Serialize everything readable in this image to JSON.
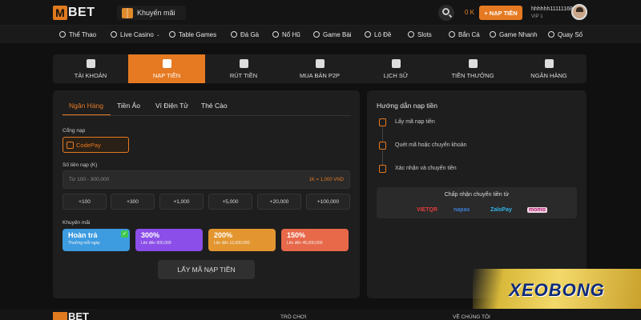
{
  "brand": {
    "logo_letter": "M",
    "logo_text": "BET"
  },
  "header": {
    "promo_label": "Khuyến mãi",
    "balance": "0 K",
    "deposit_button": "+ NẠP TIỀN",
    "username": "hhhhhh11111168",
    "vip": "VIP 1"
  },
  "nav": [
    "Thể Thao",
    "Live Casino",
    "Table Games",
    "Đá Gà",
    "Nổ Hũ",
    "Game Bài",
    "Lô Đề",
    "Slots",
    "Bắn Cá",
    "Game Nhanh",
    "Quay Số"
  ],
  "tabs": [
    {
      "label": "TÀI KHOẢN",
      "icon": "user-icon",
      "active": false
    },
    {
      "label": "NẠP TIỀN",
      "icon": "wallet-icon",
      "active": true
    },
    {
      "label": "RÚT TIỀN",
      "icon": "withdraw-icon",
      "active": false
    },
    {
      "label": "MUA BÁN P2P",
      "icon": "exchange-icon",
      "active": false
    },
    {
      "label": "LỊCH SỬ",
      "icon": "history-icon",
      "active": false
    },
    {
      "label": "TIỀN THƯỞNG",
      "icon": "bonus-icon",
      "active": false
    },
    {
      "label": "NGÂN HÀNG",
      "icon": "bank-icon",
      "active": false
    }
  ],
  "deposit": {
    "methods": [
      "Ngân Hàng",
      "Tiền Ảo",
      "Ví Điện Tử",
      "Thẻ Cào"
    ],
    "gateway_label": "Cổng nạp",
    "gateway": "CodePay",
    "amount_label": "Số tiền nạp (K)",
    "amount_placeholder": "Từ 100 - 300,000",
    "amount_note": "1K = 1,000 VND",
    "quick_amounts": [
      "+100",
      "+300",
      "+1,000",
      "+5,000",
      "+20,000",
      "+100,000"
    ],
    "promo_label": "Khuyến mãi",
    "promos": [
      {
        "title": "Hoàn trả",
        "sub": "Thưởng mỗi ngày",
        "color": "#3d9be0",
        "selected": true
      },
      {
        "title": "300%",
        "sub": "Lên đến 900,000",
        "color": "#8b4ee8",
        "selected": false
      },
      {
        "title": "200%",
        "sub": "Lên đến 12,600,000",
        "color": "#e3962f",
        "selected": false
      },
      {
        "title": "150%",
        "sub": "Lên đến 45,000,000",
        "color": "#e8684a",
        "selected": false
      }
    ],
    "submit": "LẤY MÃ NẠP TIỀN"
  },
  "guide": {
    "title": "Hướng dẫn nạp tiền",
    "steps": [
      "Lấy mã nạp tiền",
      "Quét mã hoặc chuyển khoản",
      "Xác nhận và chuyển tiền"
    ],
    "methods_title": "Chấp nhận chuyển tiền từ",
    "banks": [
      {
        "name": "VIETQR",
        "color": "#e23b3b"
      },
      {
        "name": "napas",
        "color": "#3c7fd8"
      },
      {
        "name": "ZaloPay",
        "color": "#2fb3e8"
      },
      {
        "name": "momo",
        "color": "#b0196e"
      }
    ]
  },
  "footer": {
    "col1": "TRÒ CHƠI",
    "col2": "VỀ CHÚNG TÔI"
  },
  "watermark": "XEOBONG",
  "colors": {
    "accent": "#e57a22",
    "bg": "#101010",
    "panel": "#1e1e1e"
  }
}
